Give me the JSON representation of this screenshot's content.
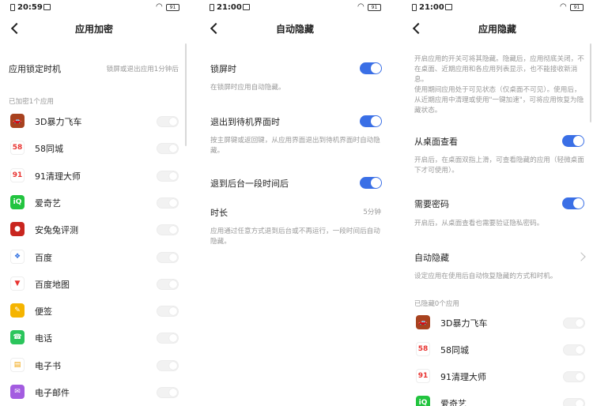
{
  "status_bars": [
    {
      "time": "20:59",
      "battery": "91"
    },
    {
      "time": "21:00",
      "battery": "91"
    },
    {
      "time": "21:00",
      "battery": "91"
    }
  ],
  "panel1": {
    "title": "应用加密",
    "lock_timing_label": "应用锁定时机",
    "lock_timing_value": "锁屏或退出应用1分钟后",
    "section_label": "已加密1个应用",
    "apps": [
      {
        "name": "3D暴力飞车",
        "icon": "racing-car-icon",
        "color": "#a8421f",
        "enabled": false
      },
      {
        "name": "58同城",
        "icon": "58-logo-icon",
        "color": "#ffffff",
        "enabled": false
      },
      {
        "name": "91清理大师",
        "icon": "cleaner-icon",
        "color": "#ffffff",
        "enabled": false
      },
      {
        "name": "爱奇艺",
        "icon": "iqiyi-icon",
        "color": "#22c43f",
        "enabled": false
      },
      {
        "name": "安兔兔评测",
        "icon": "antutu-icon",
        "color": "#c9261f",
        "enabled": false
      },
      {
        "name": "百度",
        "icon": "baidu-paw-icon",
        "color": "#ffffff",
        "enabled": false
      },
      {
        "name": "百度地图",
        "icon": "map-pin-icon",
        "color": "#ffffff",
        "enabled": false
      },
      {
        "name": "便签",
        "icon": "pencil-icon",
        "color": "#f5b400",
        "enabled": false
      },
      {
        "name": "电话",
        "icon": "phone-icon",
        "color": "#2bc55c",
        "enabled": false
      },
      {
        "name": "电子书",
        "icon": "book-icon",
        "color": "#ffffff",
        "enabled": false
      },
      {
        "name": "电子邮件",
        "icon": "mail-icon",
        "color": "#a35ce0",
        "enabled": false
      }
    ]
  },
  "panel2": {
    "title": "自动隐藏",
    "lock_screen_label": "锁屏时",
    "lock_screen_desc": "在锁屏时应用自动隐藏。",
    "exit_label": "退出到待机界面时",
    "exit_desc": "按主屏键或返回键，从应用界面退出到待机界面时自动隐藏。",
    "background_label": "退到后台一段时间后",
    "duration_label": "时长",
    "duration_value": "5分钟",
    "background_desc": "应用通过任意方式退到后台或不再运行，一段时间后自动隐藏。"
  },
  "panel3": {
    "title": "应用隐藏",
    "intro": "开启应用的开关可将其隐藏。隐藏后，应用彻底关闭，不在桌面、近期应用和各应用列表显示，也不能接收新消息。",
    "intro2": "使用期间应用处于可见状态（仅桌面不可见）。使用后，从近期应用中清理或使用\"一键加速\"，可将应用恢复为隐藏状态。",
    "desktop_view_label": "从桌面查看",
    "desktop_view_desc": "开启后，在桌面双指上滑，可查看隐藏的应用（轻微桌面下才可使用）。",
    "password_label": "需要密码",
    "password_desc": "开启后，从桌面查看也需要验证隐私密码。",
    "auto_hide_label": "自动隐藏",
    "auto_hide_desc": "设定应用在使用后自动恢复隐藏的方式和时机。",
    "section_label": "已隐藏0个应用",
    "apps": [
      {
        "name": "3D暴力飞车",
        "icon": "racing-car-icon",
        "color": "#a8421f"
      },
      {
        "name": "58同城",
        "icon": "58-logo-icon",
        "color": "#ffffff"
      },
      {
        "name": "91清理大师",
        "icon": "cleaner-icon",
        "color": "#ffffff"
      },
      {
        "name": "爱奇艺",
        "icon": "iqiyi-icon",
        "color": "#22c43f"
      }
    ]
  }
}
